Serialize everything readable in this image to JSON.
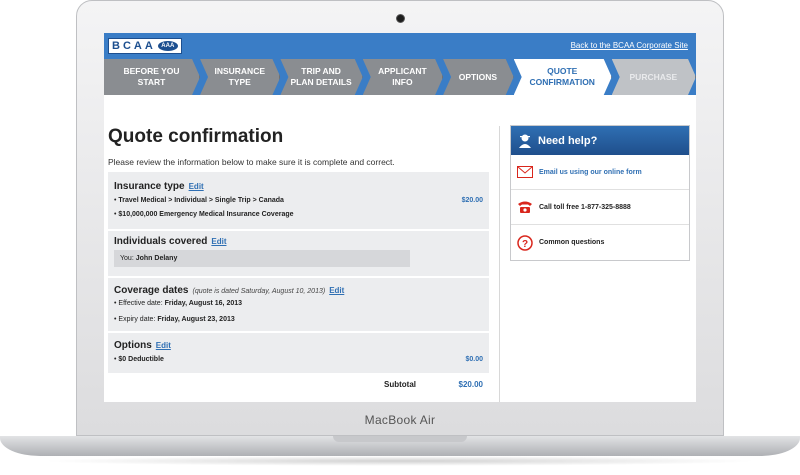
{
  "laptop": {
    "brand": "MacBook Air"
  },
  "header": {
    "logo": "BCAA",
    "logo_badge": "AAA",
    "corp_link": "Back to the BCAA Corporate Site",
    "steps": [
      {
        "line1": "BEFORE YOU",
        "line2": "START"
      },
      {
        "line1": "INSURANCE",
        "line2": "TYPE"
      },
      {
        "line1": "TRIP AND",
        "line2": "PLAN DETAILS"
      },
      {
        "line1": "APPLICANT",
        "line2": "INFO"
      },
      {
        "line1": "OPTIONS",
        "line2": ""
      },
      {
        "line1": "QUOTE",
        "line2": "CONFIRMATION"
      },
      {
        "line1": "PURCHASE",
        "line2": ""
      }
    ]
  },
  "main": {
    "title": "Quote confirmation",
    "intro": "Please review the information below to make sure it is complete and correct.",
    "insurance_type": {
      "heading": "Insurance type",
      "edit": "Edit",
      "line1": "Travel Medical > Individual > Single Trip > Canada",
      "line2": "$10,000,000 Emergency Medical Insurance Coverage",
      "price": "$20.00"
    },
    "individuals": {
      "heading": "Individuals covered",
      "edit": "Edit",
      "you_label": "You:",
      "you_name": "John Delany"
    },
    "coverage": {
      "heading": "Coverage dates",
      "note": "(quote is dated Saturday, August 10, 2013)",
      "edit": "Edit",
      "effective_label": "Effective date:",
      "effective_value": "Friday, August 16, 2013",
      "expiry_label": "Expiry date:",
      "expiry_value": "Friday, August 23, 2013"
    },
    "options": {
      "heading": "Options",
      "edit": "Edit",
      "line1": "$0 Deductible",
      "price": "$0.00"
    },
    "subtotal": {
      "label": "Subtotal",
      "value": "$20.00"
    }
  },
  "help": {
    "title": "Need help?",
    "email": "Email us using our online form",
    "phone": "Call toll free 1-877-325-8888",
    "questions": "Common questions"
  },
  "colors": {
    "brand_blue": "#3a7dc6",
    "link_blue": "#2f6fb3",
    "accent_red": "#d9261c"
  }
}
